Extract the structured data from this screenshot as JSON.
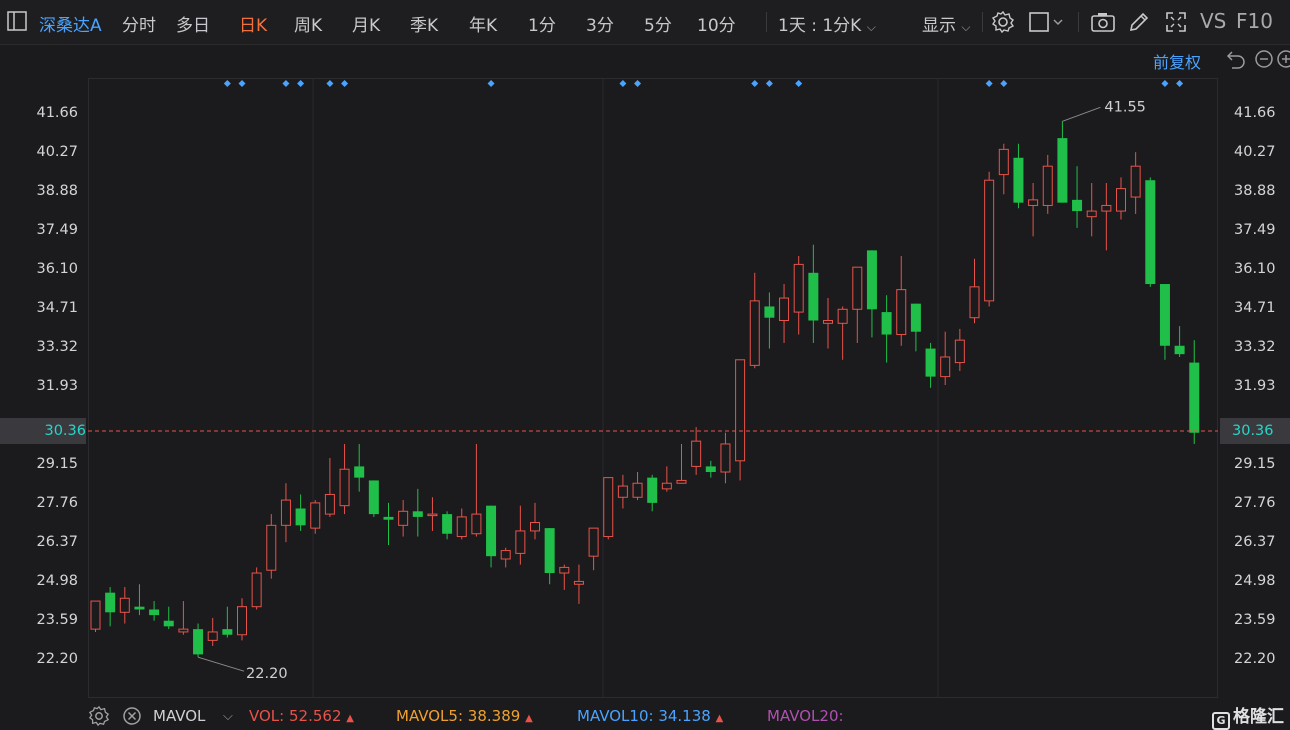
{
  "toolbar": {
    "stock_name": "深桑达A",
    "periods": [
      "分时",
      "多日",
      "日K",
      "周K",
      "月K",
      "季K",
      "年K",
      "1分",
      "3分",
      "5分",
      "10分"
    ],
    "active_period": "日K",
    "range_select": "1天 : 1分K",
    "display_label": "显示",
    "vs_label": "VS",
    "f10_label": "F10",
    "icons": [
      "panel-icon",
      "settings-icon",
      "square-icon",
      "camera-icon",
      "pen-icon",
      "fullscreen-icon"
    ]
  },
  "chart_header": {
    "adjust_label": "前复权"
  },
  "price_axis": {
    "ticks": [
      "41.66",
      "40.27",
      "38.88",
      "37.49",
      "36.10",
      "34.71",
      "33.32",
      "31.93",
      "30.36",
      "29.15",
      "27.76",
      "26.37",
      "24.98",
      "23.59",
      "22.20"
    ],
    "current_price": "30.36"
  },
  "annotations": {
    "high_label": "41.55",
    "low_label": "22.20"
  },
  "chart_data": {
    "type": "candlestick",
    "ylim": [
      21.2,
      42.9
    ],
    "up_color": "#e8534a",
    "down_color": "#1fbf4a",
    "candles": [
      {
        "o": 23.3,
        "h": 24.3,
        "l": 23.2,
        "c": 24.3
      },
      {
        "o": 24.6,
        "h": 24.8,
        "l": 23.4,
        "c": 23.9
      },
      {
        "o": 23.9,
        "h": 24.8,
        "l": 23.5,
        "c": 24.4
      },
      {
        "o": 24.1,
        "h": 24.9,
        "l": 23.8,
        "c": 24.0
      },
      {
        "o": 24.0,
        "h": 24.3,
        "l": 23.6,
        "c": 23.8
      },
      {
        "o": 23.6,
        "h": 24.1,
        "l": 23.3,
        "c": 23.4
      },
      {
        "o": 23.2,
        "h": 24.3,
        "l": 23.1,
        "c": 23.3
      },
      {
        "o": 23.3,
        "h": 23.5,
        "l": 22.3,
        "c": 22.4
      },
      {
        "o": 22.9,
        "h": 23.7,
        "l": 22.7,
        "c": 23.2
      },
      {
        "o": 23.3,
        "h": 24.1,
        "l": 23.0,
        "c": 23.1
      },
      {
        "o": 23.1,
        "h": 24.4,
        "l": 22.9,
        "c": 24.1
      },
      {
        "o": 24.1,
        "h": 25.5,
        "l": 24.0,
        "c": 25.3
      },
      {
        "o": 25.4,
        "h": 27.4,
        "l": 25.1,
        "c": 27.0
      },
      {
        "o": 27.0,
        "h": 28.5,
        "l": 26.4,
        "c": 27.9
      },
      {
        "o": 27.6,
        "h": 28.1,
        "l": 26.8,
        "c": 27.0
      },
      {
        "o": 26.9,
        "h": 27.9,
        "l": 26.7,
        "c": 27.8
      },
      {
        "o": 27.4,
        "h": 29.4,
        "l": 27.3,
        "c": 28.1
      },
      {
        "o": 27.7,
        "h": 29.9,
        "l": 27.4,
        "c": 29.0
      },
      {
        "o": 29.1,
        "h": 29.9,
        "l": 28.2,
        "c": 28.7
      },
      {
        "o": 28.6,
        "h": 28.6,
        "l": 27.3,
        "c": 27.4
      },
      {
        "o": 27.3,
        "h": 27.8,
        "l": 26.3,
        "c": 27.2
      },
      {
        "o": 27.0,
        "h": 27.9,
        "l": 26.6,
        "c": 27.5
      },
      {
        "o": 27.5,
        "h": 28.3,
        "l": 26.6,
        "c": 27.3
      },
      {
        "o": 27.4,
        "h": 28.0,
        "l": 26.8,
        "c": 27.4
      },
      {
        "o": 27.4,
        "h": 27.5,
        "l": 26.5,
        "c": 26.7
      },
      {
        "o": 26.6,
        "h": 27.6,
        "l": 26.5,
        "c": 27.3
      },
      {
        "o": 26.7,
        "h": 29.9,
        "l": 26.6,
        "c": 27.4
      },
      {
        "o": 27.7,
        "h": 27.7,
        "l": 25.5,
        "c": 25.9
      },
      {
        "o": 25.8,
        "h": 26.2,
        "l": 25.5,
        "c": 26.1
      },
      {
        "o": 26.0,
        "h": 27.7,
        "l": 25.6,
        "c": 26.8
      },
      {
        "o": 26.8,
        "h": 27.8,
        "l": 26.5,
        "c": 27.1
      },
      {
        "o": 26.9,
        "h": 26.9,
        "l": 24.9,
        "c": 25.3
      },
      {
        "o": 25.3,
        "h": 25.6,
        "l": 24.7,
        "c": 25.5
      },
      {
        "o": 24.9,
        "h": 25.6,
        "l": 24.2,
        "c": 25.0
      },
      {
        "o": 25.9,
        "h": 26.9,
        "l": 25.4,
        "c": 26.9
      },
      {
        "o": 26.6,
        "h": 28.7,
        "l": 26.5,
        "c": 28.7
      },
      {
        "o": 28.0,
        "h": 28.8,
        "l": 27.6,
        "c": 28.4
      },
      {
        "o": 28.0,
        "h": 28.9,
        "l": 27.9,
        "c": 28.5
      },
      {
        "o": 28.7,
        "h": 28.8,
        "l": 27.5,
        "c": 27.8
      },
      {
        "o": 28.3,
        "h": 29.1,
        "l": 28.2,
        "c": 28.5
      },
      {
        "o": 28.5,
        "h": 29.9,
        "l": 28.5,
        "c": 28.6
      },
      {
        "o": 29.1,
        "h": 30.5,
        "l": 28.8,
        "c": 30.0
      },
      {
        "o": 29.1,
        "h": 29.3,
        "l": 28.7,
        "c": 28.9
      },
      {
        "o": 28.9,
        "h": 30.3,
        "l": 28.5,
        "c": 29.9
      },
      {
        "o": 29.3,
        "h": 32.3,
        "l": 28.6,
        "c": 32.9
      },
      {
        "o": 32.7,
        "h": 36.0,
        "l": 32.6,
        "c": 35.0
      },
      {
        "o": 34.8,
        "h": 35.3,
        "l": 33.3,
        "c": 34.4
      },
      {
        "o": 34.3,
        "h": 35.6,
        "l": 33.5,
        "c": 35.1
      },
      {
        "o": 34.6,
        "h": 36.6,
        "l": 33.8,
        "c": 36.3
      },
      {
        "o": 36.0,
        "h": 37.0,
        "l": 33.5,
        "c": 34.3
      },
      {
        "o": 34.2,
        "h": 35.1,
        "l": 33.3,
        "c": 34.3
      },
      {
        "o": 34.2,
        "h": 34.8,
        "l": 32.9,
        "c": 34.7
      },
      {
        "o": 34.7,
        "h": 36.2,
        "l": 33.5,
        "c": 36.2
      },
      {
        "o": 36.8,
        "h": 36.8,
        "l": 33.7,
        "c": 34.7
      },
      {
        "o": 34.6,
        "h": 35.2,
        "l": 32.8,
        "c": 33.8
      },
      {
        "o": 33.8,
        "h": 36.6,
        "l": 33.4,
        "c": 35.4
      },
      {
        "o": 34.9,
        "h": 34.9,
        "l": 33.2,
        "c": 33.9
      },
      {
        "o": 33.3,
        "h": 33.5,
        "l": 31.9,
        "c": 32.3
      },
      {
        "o": 32.3,
        "h": 33.9,
        "l": 32.0,
        "c": 33.0
      },
      {
        "o": 32.8,
        "h": 34.0,
        "l": 32.5,
        "c": 33.6
      },
      {
        "o": 34.4,
        "h": 36.5,
        "l": 34.2,
        "c": 35.5
      },
      {
        "o": 35.0,
        "h": 39.6,
        "l": 34.8,
        "c": 39.3
      },
      {
        "o": 39.5,
        "h": 40.6,
        "l": 38.8,
        "c": 40.4
      },
      {
        "o": 40.1,
        "h": 40.6,
        "l": 38.3,
        "c": 38.5
      },
      {
        "o": 38.4,
        "h": 39.2,
        "l": 37.3,
        "c": 38.6
      },
      {
        "o": 38.4,
        "h": 40.2,
        "l": 38.1,
        "c": 39.8
      },
      {
        "o": 40.8,
        "h": 41.4,
        "l": 38.5,
        "c": 38.5
      },
      {
        "o": 38.6,
        "h": 39.8,
        "l": 37.6,
        "c": 38.2
      },
      {
        "o": 38.0,
        "h": 39.2,
        "l": 37.3,
        "c": 38.2
      },
      {
        "o": 38.2,
        "h": 39.2,
        "l": 36.8,
        "c": 38.4
      },
      {
        "o": 38.2,
        "h": 39.4,
        "l": 37.9,
        "c": 39.0
      },
      {
        "o": 38.7,
        "h": 40.3,
        "l": 38.1,
        "c": 39.8
      },
      {
        "o": 39.3,
        "h": 39.4,
        "l": 35.5,
        "c": 35.6
      },
      {
        "o": 35.6,
        "h": 35.6,
        "l": 32.9,
        "c": 33.4
      },
      {
        "o": 33.4,
        "h": 34.1,
        "l": 33.0,
        "c": 33.1
      },
      {
        "o": 32.8,
        "h": 33.6,
        "l": 29.9,
        "c": 30.3
      }
    ],
    "ticks": [
      41.66,
      40.27,
      38.88,
      37.49,
      36.1,
      34.71,
      33.32,
      31.93,
      30.36,
      29.15,
      27.76,
      26.37,
      24.98,
      23.59,
      22.2
    ],
    "current_price": 30.36,
    "high": 41.55,
    "low": 22.2,
    "markers_at_candles": [
      9,
      10,
      13,
      14,
      16,
      17,
      27,
      36,
      37,
      45,
      46,
      48,
      61,
      62,
      73,
      74
    ]
  },
  "bottom_bar": {
    "indicator": "MAVOL",
    "vol_label": "VOL:",
    "vol_value": "52.562",
    "mavol5_label": "MAVOL5:",
    "mavol5_value": "38.389",
    "mavol10_label": "MAVOL10:",
    "mavol10_value": "34.138",
    "mavol20_label": "MAVOL20:",
    "colors": {
      "vol": "#e8534a",
      "mavol5": "#f0a030",
      "mavol10": "#4aa3ff",
      "mavol20": "#b050b0"
    },
    "brand": "格隆汇"
  }
}
